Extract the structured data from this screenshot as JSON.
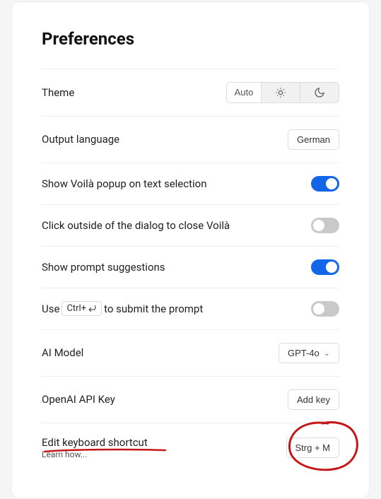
{
  "title": "Preferences",
  "rows": {
    "theme": {
      "label": "Theme",
      "auto": "Auto"
    },
    "language": {
      "label": "Output language",
      "value": "German"
    },
    "popup": {
      "label": "Show Voilà popup on text selection",
      "on": true
    },
    "clickOutside": {
      "label": "Click outside of the dialog to close Voilà",
      "on": false
    },
    "suggestions": {
      "label": "Show prompt suggestions",
      "on": true
    },
    "ctrlEnter": {
      "prefix": "Use",
      "kbd": "Ctrl+",
      "suffix": "to submit the prompt",
      "on": false
    },
    "model": {
      "label": "AI Model",
      "value": "GPT-4o"
    },
    "apikey": {
      "label": "OpenAI API Key",
      "button": "Add key"
    },
    "shortcut": {
      "label": "Edit keyboard shortcut",
      "sublabel": "Learn how...",
      "value": "Strg + M"
    }
  },
  "annotation": {
    "color": "#c41818"
  }
}
